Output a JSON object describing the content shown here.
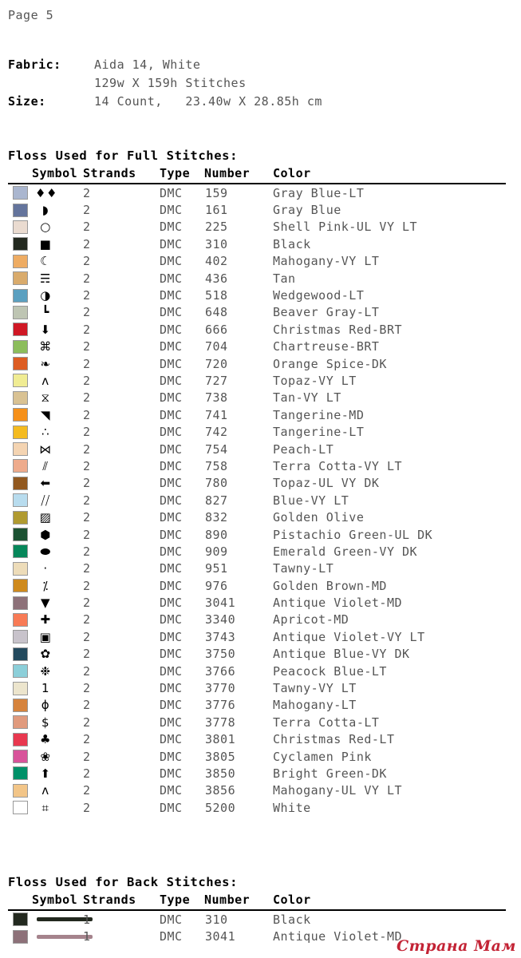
{
  "page_label": "Page 5",
  "meta": {
    "fabric_key": "Fabric:",
    "fabric_value": "Aida 14, White",
    "fabric_value2": "129w X 159h Stitches",
    "size_key": "Size:",
    "size_value": "14 Count,   23.40w X 28.85h cm"
  },
  "full_stitches": {
    "title": "Floss Used for Full Stitches:",
    "headers": {
      "symbol": "Symbol",
      "strands": "Strands",
      "type": "Type",
      "number": "Number",
      "color": "Color"
    },
    "rows": [
      {
        "swatch": "#aab6cf",
        "symbol": "♦♦",
        "symbol_name": "two-diamonds",
        "strands": "2",
        "type": "DMC",
        "number": "159",
        "color": "Gray Blue-LT"
      },
      {
        "swatch": "#64749c",
        "symbol": "◗",
        "symbol_name": "quarter-disc",
        "strands": "2",
        "type": "DMC",
        "number": "161",
        "color": "Gray Blue"
      },
      {
        "swatch": "#eadbd0",
        "symbol": "○",
        "symbol_name": "open-circle",
        "strands": "2",
        "type": "DMC",
        "number": "225",
        "color": "Shell Pink-UL VY LT"
      },
      {
        "swatch": "#23291f",
        "symbol": "■",
        "symbol_name": "filled-square",
        "strands": "2",
        "type": "DMC",
        "number": "310",
        "color": "Black"
      },
      {
        "swatch": "#eeac63",
        "symbol": "☾",
        "symbol_name": "crescent-moon",
        "strands": "2",
        "type": "DMC",
        "number": "402",
        "color": "Mahogany-VY LT"
      },
      {
        "swatch": "#d9ab6c",
        "symbol": "☴",
        "symbol_name": "trident",
        "strands": "2",
        "type": "DMC",
        "number": "436",
        "color": "Tan"
      },
      {
        "swatch": "#5ba0c0",
        "symbol": "◑",
        "symbol_name": "half-disc",
        "strands": "2",
        "type": "DMC",
        "number": "518",
        "color": "Wedgewood-LT"
      },
      {
        "swatch": "#bec5b3",
        "symbol": "┗",
        "symbol_name": "corner-l",
        "strands": "2",
        "type": "DMC",
        "number": "648",
        "color": "Beaver Gray-LT"
      },
      {
        "swatch": "#d01825",
        "symbol": "⬇",
        "symbol_name": "down-arrow",
        "strands": "2",
        "type": "DMC",
        "number": "666",
        "color": "Christmas Red-BRT"
      },
      {
        "swatch": "#8cbd5c",
        "symbol": "⌘",
        "symbol_name": "boxed-asterisk",
        "strands": "2",
        "type": "DMC",
        "number": "704",
        "color": "Chartreuse-BRT"
      },
      {
        "swatch": "#dd5c22",
        "symbol": "❧",
        "symbol_name": "comma-blob",
        "strands": "2",
        "type": "DMC",
        "number": "720",
        "color": "Orange Spice-DK"
      },
      {
        "swatch": "#f0ec93",
        "symbol": "ʌ",
        "symbol_name": "caret",
        "strands": "2",
        "type": "DMC",
        "number": "727",
        "color": "Topaz-VY LT"
      },
      {
        "swatch": "#d9c293",
        "symbol": "⧖",
        "symbol_name": "hourglass",
        "strands": "2",
        "type": "DMC",
        "number": "738",
        "color": "Tan-VY LT"
      },
      {
        "swatch": "#f69019",
        "symbol": "◥",
        "symbol_name": "half-filled-square",
        "strands": "2",
        "type": "DMC",
        "number": "741",
        "color": "Tangerine-MD"
      },
      {
        "swatch": "#f4bb20",
        "symbol": "∴",
        "symbol_name": "therefore-dots",
        "strands": "2",
        "type": "DMC",
        "number": "742",
        "color": "Tangerine-LT"
      },
      {
        "swatch": "#f4d4b2",
        "symbol": "⋈",
        "symbol_name": "bowtie",
        "strands": "2",
        "type": "DMC",
        "number": "754",
        "color": "Peach-LT"
      },
      {
        "swatch": "#eeab8c",
        "symbol": "⫽",
        "symbol_name": "double-slash",
        "strands": "2",
        "type": "DMC",
        "number": "758",
        "color": "Terra Cotta-VY LT"
      },
      {
        "swatch": "#91581f",
        "symbol": "⬅",
        "symbol_name": "left-arrow",
        "strands": "2",
        "type": "DMC",
        "number": "780",
        "color": "Topaz-UL VY DK"
      },
      {
        "swatch": "#b8dcee",
        "symbol": "⧸⧸",
        "symbol_name": "triple-slash",
        "strands": "2",
        "type": "DMC",
        "number": "827",
        "color": "Blue-VY LT"
      },
      {
        "swatch": "#b09a30",
        "symbol": "▨",
        "symbol_name": "checker-square",
        "strands": "2",
        "type": "DMC",
        "number": "832",
        "color": "Golden Olive"
      },
      {
        "swatch": "#1c5232",
        "symbol": "⬢",
        "symbol_name": "filled-hexagon",
        "strands": "2",
        "type": "DMC",
        "number": "890",
        "color": "Pistachio Green-UL DK"
      },
      {
        "swatch": "#06875a",
        "symbol": "⬬",
        "symbol_name": "tilted-blob",
        "strands": "2",
        "type": "DMC",
        "number": "909",
        "color": "Emerald Green-VY DK"
      },
      {
        "swatch": "#eddcb9",
        "symbol": "·",
        "symbol_name": "small-dot",
        "strands": "2",
        "type": "DMC",
        "number": "951",
        "color": "Tawny-LT"
      },
      {
        "swatch": "#cf8a1d",
        "symbol": "⁒",
        "symbol_name": "percent-slash",
        "strands": "2",
        "type": "DMC",
        "number": "976",
        "color": "Golden Brown-MD"
      },
      {
        "swatch": "#8d7179",
        "symbol": "▼",
        "symbol_name": "down-triangle",
        "strands": "2",
        "type": "DMC",
        "number": "3041",
        "color": "Antique Violet-MD"
      },
      {
        "swatch": "#f87b56",
        "symbol": "✚",
        "symbol_name": "bold-plus",
        "strands": "2",
        "type": "DMC",
        "number": "3340",
        "color": "Apricot-MD"
      },
      {
        "swatch": "#c8c3cb",
        "symbol": "▣",
        "symbol_name": "nested-square",
        "strands": "2",
        "type": "DMC",
        "number": "3743",
        "color": "Antique Violet-VY LT"
      },
      {
        "swatch": "#234a5e",
        "symbol": "✿",
        "symbol_name": "flower",
        "strands": "2",
        "type": "DMC",
        "number": "3750",
        "color": "Antique Blue-VY DK"
      },
      {
        "swatch": "#8ccfd9",
        "symbol": "❉",
        "symbol_name": "teardrop-asterisk",
        "strands": "2",
        "type": "DMC",
        "number": "3766",
        "color": "Peacock Blue-LT"
      },
      {
        "swatch": "#ece5cd",
        "symbol": "1",
        "symbol_name": "digit-one",
        "strands": "2",
        "type": "DMC",
        "number": "3770",
        "color": "Tawny-VY LT"
      },
      {
        "swatch": "#d6833c",
        "symbol": "ϕ",
        "symbol_name": "phi",
        "strands": "2",
        "type": "DMC",
        "number": "3776",
        "color": "Mahogany-LT"
      },
      {
        "swatch": "#e09a7d",
        "symbol": "$",
        "symbol_name": "dollar-sign",
        "strands": "2",
        "type": "DMC",
        "number": "3778",
        "color": "Terra Cotta-LT"
      },
      {
        "swatch": "#e8384f",
        "symbol": "♣",
        "symbol_name": "club",
        "strands": "2",
        "type": "DMC",
        "number": "3801",
        "color": "Christmas Red-LT"
      },
      {
        "swatch": "#d8539a",
        "symbol": "❀",
        "symbol_name": "floral-asterisk",
        "strands": "2",
        "type": "DMC",
        "number": "3805",
        "color": "Cyclamen Pink"
      },
      {
        "swatch": "#009068",
        "symbol": "⬆",
        "symbol_name": "up-arrow",
        "strands": "2",
        "type": "DMC",
        "number": "3850",
        "color": "Bright Green-DK"
      },
      {
        "swatch": "#f2c588",
        "symbol": "ʌ",
        "symbol_name": "caret-thin",
        "strands": "2",
        "type": "DMC",
        "number": "3856",
        "color": "Mahogany-UL VY LT"
      },
      {
        "swatch": "#ffffff",
        "symbol": "⌗",
        "symbol_name": "hash",
        "strands": "2",
        "type": "DMC",
        "number": "5200",
        "color": "White"
      }
    ]
  },
  "back_stitches": {
    "title": "Floss Used for Back Stitches:",
    "headers": {
      "symbol": "Symbol",
      "strands": "Strands",
      "type": "Type",
      "number": "Number",
      "color": "Color"
    },
    "rows": [
      {
        "swatch": "#23291f",
        "line_color": "#23291f",
        "strands": "1",
        "type": "DMC",
        "number": "310",
        "color": "Black"
      },
      {
        "swatch": "#8d7179",
        "line_color": "#a5838c",
        "strands": "1",
        "type": "DMC",
        "number": "3041",
        "color": "Antique Violet-MD"
      }
    ]
  },
  "watermark": "Страна Мам"
}
